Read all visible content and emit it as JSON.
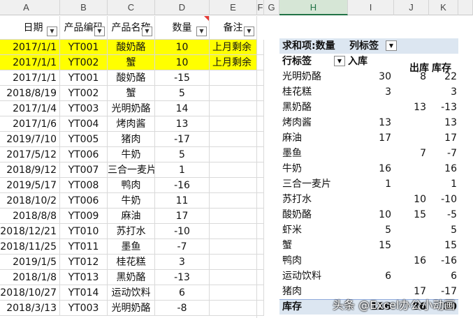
{
  "columns": [
    "A",
    "B",
    "C",
    "D",
    "E",
    "F",
    "G",
    "H",
    "I",
    "J",
    "K"
  ],
  "table": {
    "headers": [
      "日期",
      "产品编码",
      "产品名称",
      "数量",
      "备注"
    ],
    "rows": [
      {
        "date": "2017/1/1",
        "code": "YT001",
        "name": "酸奶酪",
        "qty": "10",
        "note": "上月剩余",
        "hl": true
      },
      {
        "date": "2017/1/1",
        "code": "YT002",
        "name": "蟹",
        "qty": "10",
        "note": "上月剩余",
        "hl": true
      },
      {
        "date": "2017/1/1",
        "code": "YT001",
        "name": "酸奶酪",
        "qty": "-15",
        "note": "",
        "hl": false
      },
      {
        "date": "2018/8/19",
        "code": "YT002",
        "name": "蟹",
        "qty": "5",
        "note": "",
        "hl": false
      },
      {
        "date": "2017/1/4",
        "code": "YT003",
        "name": "光明奶酪",
        "qty": "14",
        "note": "",
        "hl": false
      },
      {
        "date": "2017/1/6",
        "code": "YT004",
        "name": "烤肉酱",
        "qty": "13",
        "note": "",
        "hl": false
      },
      {
        "date": "2019/7/10",
        "code": "YT005",
        "name": "猪肉",
        "qty": "-17",
        "note": "",
        "hl": false
      },
      {
        "date": "2017/5/12",
        "code": "YT006",
        "name": "牛奶",
        "qty": "5",
        "note": "",
        "hl": false
      },
      {
        "date": "2018/9/12",
        "code": "YT007",
        "name": "三合一麦片",
        "qty": "1",
        "note": "",
        "hl": false
      },
      {
        "date": "2019/5/17",
        "code": "YT008",
        "name": "鸭肉",
        "qty": "-16",
        "note": "",
        "hl": false
      },
      {
        "date": "2018/10/2",
        "code": "YT006",
        "name": "牛奶",
        "qty": "11",
        "note": "",
        "hl": false
      },
      {
        "date": "2018/8/8",
        "code": "YT009",
        "name": "麻油",
        "qty": "17",
        "note": "",
        "hl": false
      },
      {
        "date": "2018/12/21",
        "code": "YT010",
        "name": "苏打水",
        "qty": "-10",
        "note": "",
        "hl": false
      },
      {
        "date": "2018/11/25",
        "code": "YT011",
        "name": "墨鱼",
        "qty": "-7",
        "note": "",
        "hl": false
      },
      {
        "date": "2019/1/5",
        "code": "YT012",
        "name": "桂花糕",
        "qty": "3",
        "note": "",
        "hl": false
      },
      {
        "date": "2018/1/8",
        "code": "YT013",
        "name": "黑奶酪",
        "qty": "-13",
        "note": "",
        "hl": false
      },
      {
        "date": "2018/10/27",
        "code": "YT014",
        "name": "运动饮料",
        "qty": "6",
        "note": "",
        "hl": false
      },
      {
        "date": "2018/3/13",
        "code": "YT003",
        "name": "光明奶酪",
        "qty": "-8",
        "note": "",
        "hl": false
      }
    ]
  },
  "pivot": {
    "title": "求和项:数量",
    "col_label": "列标签",
    "row_label": "行标签",
    "col_headers": [
      "入库",
      "出库",
      "库存"
    ],
    "rows": [
      {
        "name": "光明奶酪",
        "in": "30",
        "out": "8",
        "stock": "22"
      },
      {
        "name": "桂花糕",
        "in": "3",
        "out": "",
        "stock": "3"
      },
      {
        "name": "黑奶酪",
        "in": "",
        "out": "13",
        "stock": "-13"
      },
      {
        "name": "烤肉酱",
        "in": "13",
        "out": "",
        "stock": "13"
      },
      {
        "name": "麻油",
        "in": "17",
        "out": "",
        "stock": "17"
      },
      {
        "name": "墨鱼",
        "in": "",
        "out": "7",
        "stock": "-7"
      },
      {
        "name": "牛奶",
        "in": "16",
        "out": "",
        "stock": "16"
      },
      {
        "name": "三合一麦片",
        "in": "1",
        "out": "",
        "stock": "1"
      },
      {
        "name": "苏打水",
        "in": "",
        "out": "10",
        "stock": "-10"
      },
      {
        "name": "酸奶酪",
        "in": "10",
        "out": "15",
        "stock": "-5"
      },
      {
        "name": "虾米",
        "in": "5",
        "out": "",
        "stock": "5"
      },
      {
        "name": "蟹",
        "in": "15",
        "out": "",
        "stock": "15"
      },
      {
        "name": "鸭肉",
        "in": "",
        "out": "16",
        "stock": "-16"
      },
      {
        "name": "运动饮料",
        "in": "6",
        "out": "",
        "stock": "6"
      },
      {
        "name": "猪肉",
        "in": "",
        "out": "17",
        "stock": "-17"
      }
    ],
    "total_label": "库存",
    "totals": {
      "in": "116",
      "out": "86",
      "stock": "30"
    }
  },
  "watermark": "头条 @Excel办公小动画",
  "colors": {
    "highlight": "#ffff00",
    "pivot_header": "#dce6f1",
    "selected_col": "#217346"
  }
}
